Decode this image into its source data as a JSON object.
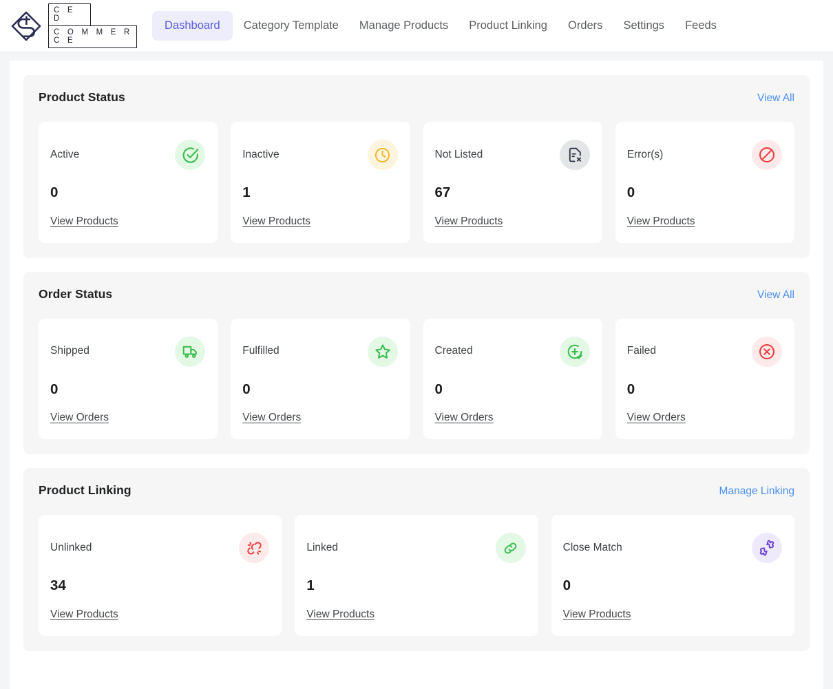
{
  "brand": {
    "logo_icon": "ced-diamond-logo",
    "line1": "C E D",
    "line2": "C O M M E R C E"
  },
  "nav": {
    "items": [
      {
        "label": "Dashboard",
        "active": true
      },
      {
        "label": "Category Template",
        "active": false
      },
      {
        "label": "Manage Products",
        "active": false
      },
      {
        "label": "Product Linking",
        "active": false
      },
      {
        "label": "Orders",
        "active": false
      },
      {
        "label": "Settings",
        "active": false
      },
      {
        "label": "Feeds",
        "active": false
      }
    ]
  },
  "colors": {
    "accent_link": "#4a90f0",
    "nav_active_text": "#5c5ce0",
    "nav_active_bg": "#ededfb",
    "green": "#3bbd4e",
    "amber": "#f5b722",
    "red": "#f03c3c",
    "gray": "#374151",
    "purple": "#6c3fd4"
  },
  "sections": [
    {
      "title": "Product Status",
      "action_label": "View All",
      "columns": 4,
      "cards": [
        {
          "label": "Active",
          "value": "0",
          "link": "View Products",
          "icon": "check-circle-icon",
          "icon_color": "#3bbd4e",
          "icon_bg": "#e3f9e6"
        },
        {
          "label": "Inactive",
          "value": "1",
          "link": "View Products",
          "icon": "clock-icon",
          "icon_color": "#f5b722",
          "icon_bg": "#fdf4df"
        },
        {
          "label": "Not Listed",
          "value": "67",
          "link": "View Products",
          "icon": "file-x-icon",
          "icon_color": "#374151",
          "icon_bg": "#e3e5e7"
        },
        {
          "label": "Error(s)",
          "value": "0",
          "link": "View Products",
          "icon": "prohibited-icon",
          "icon_color": "#f03c3c",
          "icon_bg": "#fdeaea"
        }
      ]
    },
    {
      "title": "Order Status",
      "action_label": "View All",
      "columns": 4,
      "cards": [
        {
          "label": "Shipped",
          "value": "0",
          "link": "View Orders",
          "icon": "truck-icon",
          "icon_color": "#3bbd4e",
          "icon_bg": "#e3f9e6"
        },
        {
          "label": "Fulfilled",
          "value": "0",
          "link": "View Orders",
          "icon": "star-icon",
          "icon_color": "#3bbd4e",
          "icon_bg": "#e3f9e6"
        },
        {
          "label": "Created",
          "value": "0",
          "link": "View Orders",
          "icon": "plus-check-circle-icon",
          "icon_color": "#3bbd4e",
          "icon_bg": "#e3f9e6"
        },
        {
          "label": "Failed",
          "value": "0",
          "link": "View Orders",
          "icon": "x-circle-icon",
          "icon_color": "#f03c3c",
          "icon_bg": "#fdeaea"
        }
      ]
    },
    {
      "title": "Product Linking",
      "action_label": "Manage Linking",
      "columns": 3,
      "cards": [
        {
          "label": "Unlinked",
          "value": "34",
          "link": "View Products",
          "icon": "broken-link-icon",
          "icon_color": "#f03c3c",
          "icon_bg": "#fdeaea"
        },
        {
          "label": "Linked",
          "value": "1",
          "link": "View Products",
          "icon": "link-icon",
          "icon_color": "#3bbd4e",
          "icon_bg": "#e3f9e6"
        },
        {
          "label": "Close Match",
          "value": "0",
          "link": "View Products",
          "icon": "puzzle-icon",
          "icon_color": "#6c3fd4",
          "icon_bg": "#eee9fb"
        }
      ]
    }
  ]
}
